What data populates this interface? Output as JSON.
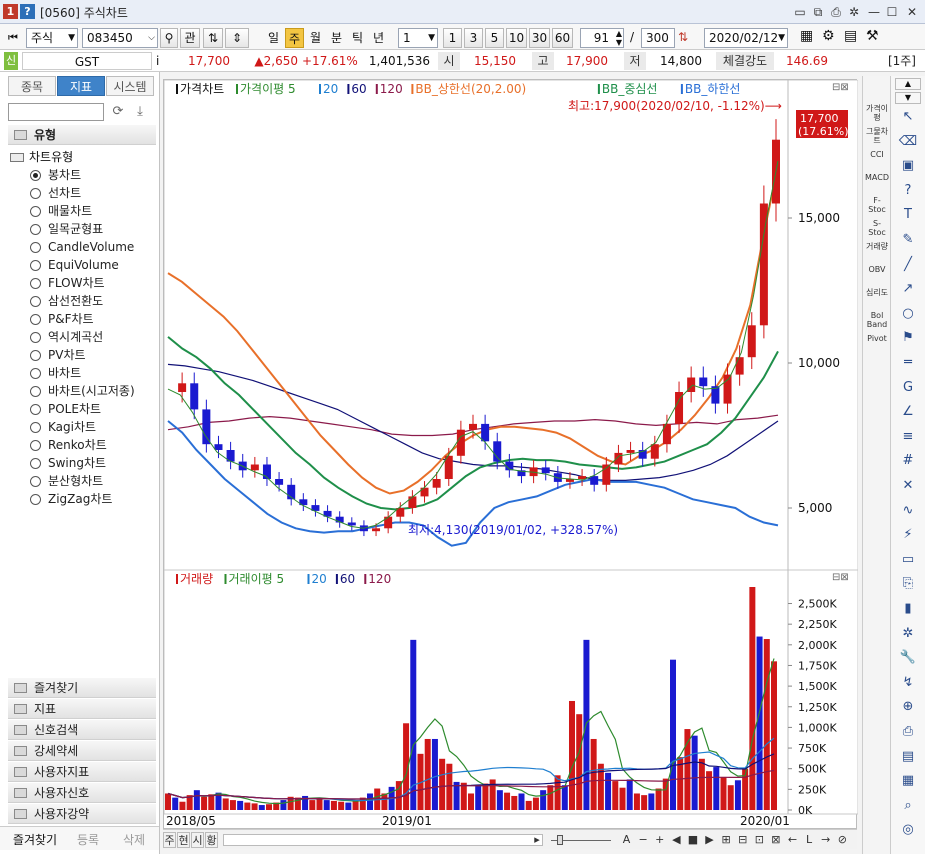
{
  "window": {
    "title": "[0560] 주식차트",
    "buttons": [
      "1",
      "?"
    ],
    "controls": [
      "restore",
      "minimize",
      "maximize",
      "close"
    ]
  },
  "toolbar": {
    "market": "주식",
    "code": "083450",
    "search_icon": "search-icon",
    "gwan": "관",
    "periods": [
      "일",
      "주",
      "월",
      "분",
      "틱",
      "년"
    ],
    "active_period": "주",
    "interval": "1",
    "quick_intervals": [
      "1",
      "3",
      "5",
      "10",
      "30",
      "60"
    ],
    "count_value": "91",
    "slash": "/",
    "total_value": "300",
    "date": "2020/02/12"
  },
  "infostrip": {
    "tag": "신",
    "name": "GST",
    "info_icon": "i",
    "price": "17,700",
    "change": "▲2,650",
    "change_pct": "+17.61%",
    "volume": "1,401,536",
    "open_label": "시",
    "open": "15,150",
    "high_label": "고",
    "high": "17,900",
    "low_label": "저",
    "low": "14,800",
    "strength_label": "체결강도",
    "strength": "146.69",
    "period_badge": "[1주]"
  },
  "leftpanel": {
    "tabs": [
      "종목",
      "지표",
      "시스템"
    ],
    "active_tab": "지표",
    "section_title": "유형",
    "tree_parent": "차트유형",
    "chart_types": [
      "봉차트",
      "선차트",
      "매물차트",
      "일목균형표",
      "CandleVolume",
      "EquiVolume",
      "FLOW차트",
      "삼선전환도",
      "P&F차트",
      "역시계곡선",
      "PV차트",
      "바차트",
      "바차트(시고저종)",
      "POLE차트",
      "Kagi차트",
      "Renko차트",
      "Swing차트",
      "분산형차트",
      "ZigZag차트"
    ],
    "selected_type": "봉차트",
    "sections": [
      "즐겨찾기",
      "지표",
      "신호검색",
      "강세약세",
      "사용자지표",
      "사용자신호",
      "사용자강약"
    ],
    "bottom_tabs": [
      "즐겨찾기",
      "등록",
      "삭제"
    ]
  },
  "price_panel": {
    "legend": [
      {
        "text": "가격차트",
        "color": "#111111"
      },
      {
        "text": "가격이평 5",
        "color": "#2e8b2e"
      },
      {
        "text": "20",
        "color": "#1f7fd0"
      },
      {
        "text": "60",
        "color": "#111177"
      },
      {
        "text": "120",
        "color": "#8b1a4a"
      },
      {
        "text": "BB_상한선(20,2.00)",
        "color": "#e8702a"
      },
      {
        "text": "BB_중심선",
        "color": "#1f8f4a"
      },
      {
        "text": "BB_하한선",
        "color": "#2a6fd6"
      }
    ],
    "max_annotation": "최고:17,900(2020/02/10, -1.12%)⟶",
    "min_annotation": "최저:4,130(2019/01/02, +328.57%)",
    "price_tag": "17,700",
    "price_tag_pct": "(17.61%)",
    "y_ticks": [
      "15,000",
      "10,000",
      "5,000"
    ]
  },
  "volume_panel": {
    "legend": [
      {
        "text": "거래량",
        "color": "#d01818"
      },
      {
        "text": "거래이평 5",
        "color": "#2e8b2e"
      },
      {
        "text": "20",
        "color": "#1f7fd0"
      },
      {
        "text": "60",
        "color": "#111177"
      },
      {
        "text": "120",
        "color": "#8b1a4a"
      }
    ],
    "y_ticks": [
      "2,500K",
      "2,250K",
      "2,000K",
      "1,750K",
      "1,500K",
      "1,250K",
      "1,000K",
      "750K",
      "500K",
      "250K",
      "0K"
    ]
  },
  "x_labels": [
    "2018/05",
    "2019/01",
    "2020/01"
  ],
  "bottombar": {
    "left_buttons": [
      "주",
      "현",
      "시",
      "황"
    ],
    "right_buttons": [
      "A",
      "−",
      "+",
      "◀",
      "■",
      "▶",
      "⊞",
      "⊟",
      "⊡",
      "⊠",
      "←",
      "L",
      "→",
      "⊘"
    ]
  },
  "indicator_strip": [
    "가격이평",
    "그물차트",
    "CCI",
    "MACD",
    "F-Stoc",
    "S-Stoc",
    "거래량",
    "OBV",
    "심리도",
    "Bol Band",
    "Pivot"
  ],
  "tool_icons": [
    "cursor-icon",
    "eraser-icon",
    "all-clear-icon",
    "help-icon",
    "text-icon",
    "pencil-icon",
    "line-icon",
    "trend-icon",
    "circle-icon",
    "fibo-icon",
    "equal-icon",
    "g-icon",
    "angle-icon",
    "channel-icon",
    "grid-icon",
    "cross-icon",
    "wave-icon",
    "auto-icon",
    "window-icon",
    "copy-icon",
    "bar-icon",
    "settings-icon",
    "wrench-icon",
    "arrow-icon",
    "zoom-icon",
    "print-icon",
    "save-icon",
    "excel-icon",
    "search-icon",
    "target-icon"
  ],
  "chart_data": {
    "type": "candlestick+line+bar",
    "price": {
      "bb_upper": [
        13100,
        12800,
        12400,
        12000,
        11600,
        11100,
        10500,
        9900,
        9300,
        8700,
        8100,
        7500,
        7000,
        6500,
        6050,
        5700,
        5500,
        5600,
        5900,
        6300,
        6800,
        7200,
        7500,
        7700,
        7800,
        7800,
        7750,
        7700,
        7600,
        7400,
        7100,
        6800,
        6600,
        6500,
        6800,
        7000,
        7300,
        7700,
        8200,
        8800,
        9500,
        10500,
        12000,
        14500,
        16800
      ],
      "bb_mid": [
        10900,
        10500,
        10200,
        9800,
        9300,
        8900,
        8400,
        7900,
        7400,
        6900,
        6500,
        6050,
        5700,
        5400,
        5150,
        5000,
        4950,
        5000,
        5100,
        5300,
        5700,
        6100,
        6400,
        6550,
        6650,
        6700,
        6650,
        6650,
        6600,
        6500,
        6450,
        6400,
        6350,
        6400,
        6500,
        6600,
        6800,
        7000,
        7200,
        7600,
        8100,
        8800,
        9500,
        10400
      ],
      "bb_lower": [
        8000,
        7600,
        7000,
        6500,
        6000,
        5600,
        5200,
        4800,
        4500,
        4300,
        4200,
        4150,
        4200,
        4200,
        4300,
        4400,
        4500,
        4500,
        4400,
        4000,
        3700,
        3800,
        4500,
        5000,
        5200,
        5300,
        5400,
        5600,
        5800,
        5900,
        6000,
        5900,
        5900,
        5900,
        5800,
        5700,
        5500,
        5300,
        5200,
        5100,
        5000,
        4700,
        4500,
        4400
      ],
      "ma60": [
        9950,
        9900,
        9800,
        9700,
        9550,
        9400,
        9200,
        9000,
        8800,
        8600,
        8400,
        8100,
        7800,
        7500,
        7200,
        6900,
        6700,
        6600,
        6500,
        6450,
        6450,
        6400,
        6350,
        6250,
        6150,
        6000,
        5950,
        5950,
        6000,
        6050,
        6150,
        6300,
        6500,
        6800,
        7200,
        7600,
        8000
      ],
      "ma120": [
        7700,
        7800,
        7950,
        8000,
        8100,
        8150,
        8100,
        8000,
        7900,
        7800,
        7700,
        7550,
        7500,
        7500,
        7550,
        7700,
        7800,
        7900,
        7950,
        8000,
        8000,
        8050,
        8000,
        7900,
        7850,
        7900,
        7950,
        7900,
        8050,
        8100,
        8200
      ],
      "candles_summary": "weekly OHLC 2018/05 → 2020/02; last close 17,700",
      "ylim": [
        3000,
        19000
      ]
    },
    "volume": {
      "unit": "K",
      "bars_k": [
        200,
        150,
        100,
        180,
        240,
        160,
        190,
        210,
        140,
        120,
        110,
        90,
        80,
        60,
        70,
        90,
        120,
        160,
        150,
        170,
        120,
        140,
        120,
        110,
        100,
        90,
        110,
        150,
        200,
        260,
        200,
        280,
        350,
        1050,
        2060,
        680,
        860,
        860,
        620,
        560,
        340,
        330,
        200,
        300,
        320,
        370,
        240,
        210,
        170,
        200,
        110,
        150,
        240,
        300,
        420,
        300,
        1320,
        1160,
        2060,
        860,
        560,
        450,
        350,
        270,
        370,
        200,
        180,
        200,
        260,
        380,
        1820,
        640,
        980,
        900,
        620,
        470,
        520,
        400,
        300,
        360,
        500,
        2700,
        2100,
        2070,
        1800
      ],
      "ylim": [
        0,
        2700
      ]
    },
    "x_labels": [
      "2018/05",
      "2019/01",
      "2020/01"
    ]
  }
}
